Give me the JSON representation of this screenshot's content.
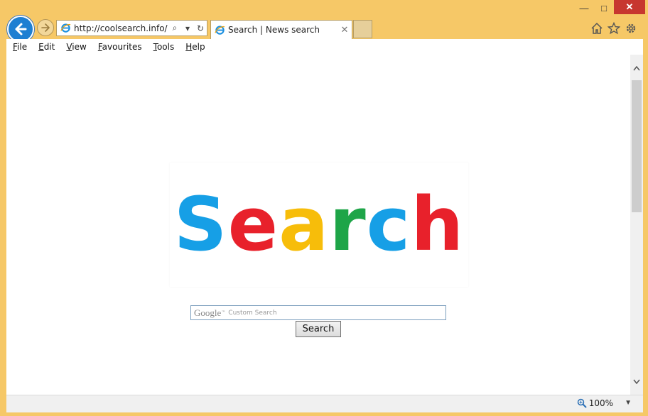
{
  "window": {
    "min_glyph": "—",
    "max_glyph": "□",
    "close_glyph": "✕"
  },
  "address_bar": {
    "url": "http://coolsearch.info/",
    "search_glyph": "⌕",
    "dropdown_glyph": "▾",
    "refresh_glyph": "↻"
  },
  "tab": {
    "title": "Search | News search",
    "close_glyph": "✕"
  },
  "toolbar_icons": {
    "home": "home-icon",
    "favorites": "star-icon",
    "tools": "gear-icon"
  },
  "menu": [
    {
      "label_first": "F",
      "label_rest": "ile"
    },
    {
      "label_first": "E",
      "label_rest": "dit"
    },
    {
      "label_first": "V",
      "label_rest": "iew"
    },
    {
      "label_first": "F",
      "label_rest": "avourites"
    },
    {
      "label_first": "T",
      "label_rest": "ools"
    },
    {
      "label_first": "H",
      "label_rest": "elp"
    }
  ],
  "logo": {
    "letters": [
      "S",
      "e",
      "a",
      "r",
      "c",
      "h"
    ],
    "colors": [
      "#169fe6",
      "#e8212b",
      "#f7bd0a",
      "#1ea548",
      "#169fe6",
      "#e8212b"
    ]
  },
  "search": {
    "google_label": "Google",
    "tm": "™",
    "custom_label": "Custom Search",
    "button_label": "Search"
  },
  "status": {
    "zoom": "100%"
  },
  "colors": {
    "frame": "#f6c867",
    "back_button": "#1e7fd2"
  }
}
